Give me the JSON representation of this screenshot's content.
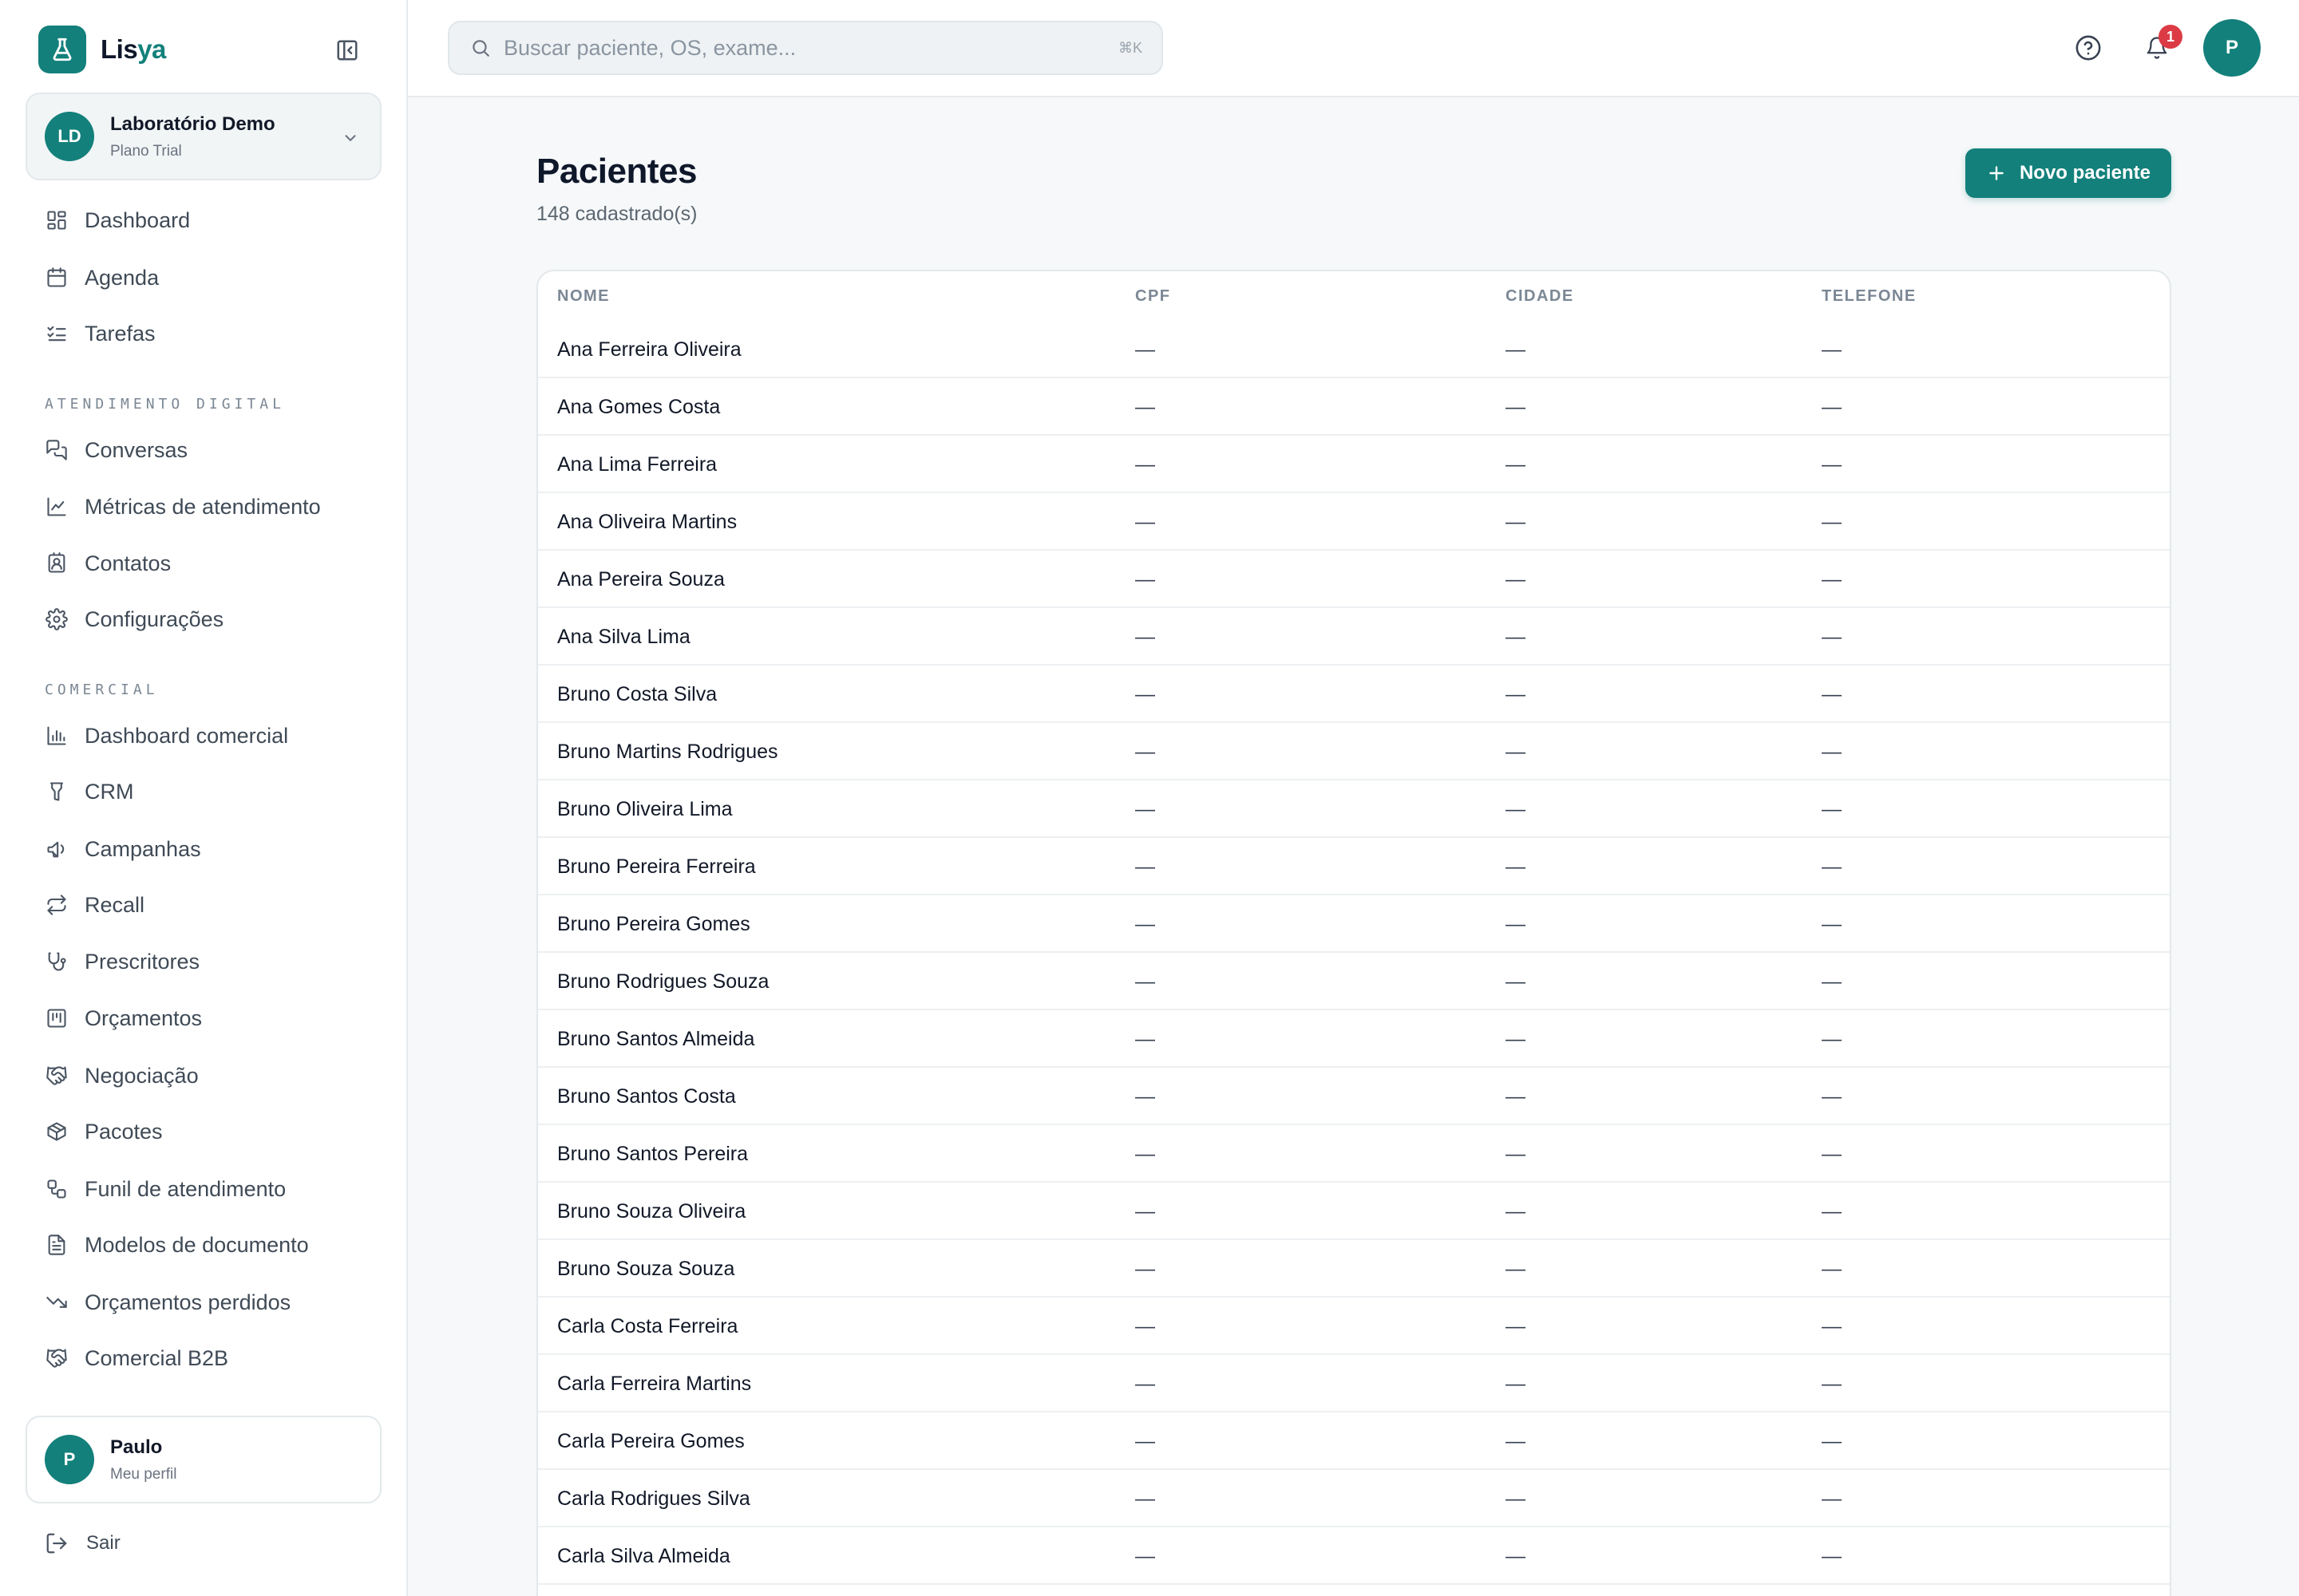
{
  "brand": {
    "name_main": "Lis",
    "name_accent": "ya"
  },
  "org": {
    "initials": "LD",
    "name": "Laboratório Demo",
    "plan": "Plano Trial"
  },
  "nav": {
    "main": [
      {
        "label": "Dashboard",
        "icon": "layout-grid-icon"
      },
      {
        "label": "Agenda",
        "icon": "calendar-icon"
      },
      {
        "label": "Tarefas",
        "icon": "list-checks-icon"
      }
    ],
    "section1_title": "ATENDIMENTO DIGITAL",
    "section1": [
      {
        "label": "Conversas",
        "icon": "messages-icon"
      },
      {
        "label": "Métricas de atendimento",
        "icon": "line-chart-icon"
      },
      {
        "label": "Contatos",
        "icon": "contact-icon"
      },
      {
        "label": "Configurações",
        "icon": "settings-icon"
      }
    ],
    "section2_title": "COMERCIAL",
    "section2": [
      {
        "label": "Dashboard comercial",
        "icon": "bar-chart-icon"
      },
      {
        "label": "CRM",
        "icon": "funnel-icon"
      },
      {
        "label": "Campanhas",
        "icon": "megaphone-icon"
      },
      {
        "label": "Recall",
        "icon": "repeat-icon"
      },
      {
        "label": "Prescritores",
        "icon": "stethoscope-icon"
      },
      {
        "label": "Orçamentos",
        "icon": "kanban-icon"
      },
      {
        "label": "Negociação",
        "icon": "handshake-icon"
      },
      {
        "label": "Pacotes",
        "icon": "package-icon"
      },
      {
        "label": "Funil de atendimento",
        "icon": "workflow-icon"
      },
      {
        "label": "Modelos de documento",
        "icon": "file-text-icon"
      },
      {
        "label": "Orçamentos perdidos",
        "icon": "trending-down-icon"
      },
      {
        "label": "Comercial B2B",
        "icon": "handshake-icon"
      }
    ]
  },
  "user": {
    "initial": "P",
    "name": "Paulo",
    "link": "Meu perfil"
  },
  "logout_label": "Sair",
  "topbar": {
    "search_placeholder": "Buscar paciente, OS, exame...",
    "search_shortcut": "⌘K",
    "notifications_count": "1",
    "avatar_initial": "P"
  },
  "page": {
    "title": "Pacientes",
    "subtitle": "148 cadastrado(s)",
    "new_button": "Novo paciente"
  },
  "table": {
    "columns": [
      "NOME",
      "CPF",
      "CIDADE",
      "TELEFONE"
    ],
    "rows": [
      {
        "nome": "Ana Ferreira Oliveira",
        "cpf": "—",
        "cidade": "—",
        "telefone": "—"
      },
      {
        "nome": "Ana Gomes Costa",
        "cpf": "—",
        "cidade": "—",
        "telefone": "—"
      },
      {
        "nome": "Ana Lima Ferreira",
        "cpf": "—",
        "cidade": "—",
        "telefone": "—"
      },
      {
        "nome": "Ana Oliveira Martins",
        "cpf": "—",
        "cidade": "—",
        "telefone": "—"
      },
      {
        "nome": "Ana Pereira Souza",
        "cpf": "—",
        "cidade": "—",
        "telefone": "—"
      },
      {
        "nome": "Ana Silva Lima",
        "cpf": "—",
        "cidade": "—",
        "telefone": "—"
      },
      {
        "nome": "Bruno Costa Silva",
        "cpf": "—",
        "cidade": "—",
        "telefone": "—"
      },
      {
        "nome": "Bruno Martins Rodrigues",
        "cpf": "—",
        "cidade": "—",
        "telefone": "—"
      },
      {
        "nome": "Bruno Oliveira Lima",
        "cpf": "—",
        "cidade": "—",
        "telefone": "—"
      },
      {
        "nome": "Bruno Pereira Ferreira",
        "cpf": "—",
        "cidade": "—",
        "telefone": "—"
      },
      {
        "nome": "Bruno Pereira Gomes",
        "cpf": "—",
        "cidade": "—",
        "telefone": "—"
      },
      {
        "nome": "Bruno Rodrigues Souza",
        "cpf": "—",
        "cidade": "—",
        "telefone": "—"
      },
      {
        "nome": "Bruno Santos Almeida",
        "cpf": "—",
        "cidade": "—",
        "telefone": "—"
      },
      {
        "nome": "Bruno Santos Costa",
        "cpf": "—",
        "cidade": "—",
        "telefone": "—"
      },
      {
        "nome": "Bruno Santos Pereira",
        "cpf": "—",
        "cidade": "—",
        "telefone": "—"
      },
      {
        "nome": "Bruno Souza Oliveira",
        "cpf": "—",
        "cidade": "—",
        "telefone": "—"
      },
      {
        "nome": "Bruno Souza Souza",
        "cpf": "—",
        "cidade": "—",
        "telefone": "—"
      },
      {
        "nome": "Carla Costa Ferreira",
        "cpf": "—",
        "cidade": "—",
        "telefone": "—"
      },
      {
        "nome": "Carla Ferreira Martins",
        "cpf": "—",
        "cidade": "—",
        "telefone": "—"
      },
      {
        "nome": "Carla Pereira Gomes",
        "cpf": "—",
        "cidade": "—",
        "telefone": "—"
      },
      {
        "nome": "Carla Rodrigues Silva",
        "cpf": "—",
        "cidade": "—",
        "telefone": "—"
      },
      {
        "nome": "Carla Silva Almeida",
        "cpf": "—",
        "cidade": "—",
        "telefone": "—"
      }
    ]
  },
  "colors": {
    "accent": "#13807b",
    "badge": "#dc3b45",
    "background": "#f6f8f9"
  }
}
